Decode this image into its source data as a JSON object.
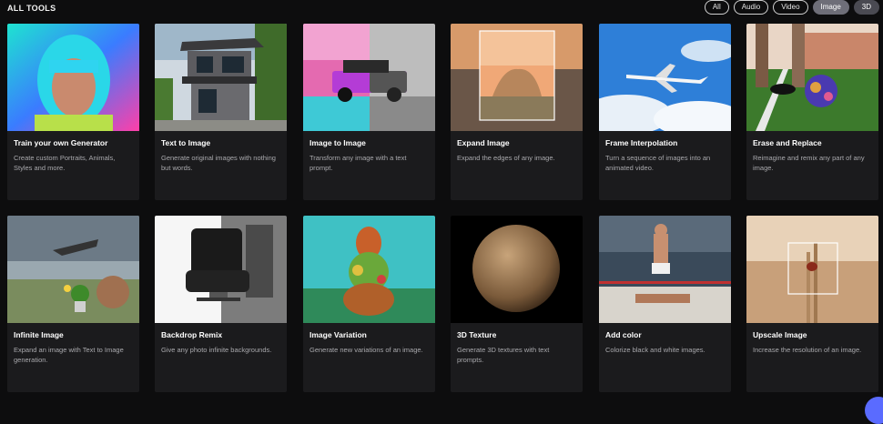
{
  "header": {
    "title": "ALL TOOLS"
  },
  "filters": [
    "All",
    "Audio",
    "Video",
    "Image",
    "3D"
  ],
  "cards": [
    {
      "title": "Train your own Generator",
      "desc": "Create custom Portraits, Animals, Styles and more."
    },
    {
      "title": "Text to Image",
      "desc": "Generate original images with nothing but words."
    },
    {
      "title": "Image to Image",
      "desc": "Transform any image with a text prompt."
    },
    {
      "title": "Expand Image",
      "desc": "Expand the edges of any image."
    },
    {
      "title": "Frame Interpolation",
      "desc": "Turn a sequence of images into an animated video."
    },
    {
      "title": "Erase and Replace",
      "desc": "Reimagine and remix any part of any image."
    },
    {
      "title": "Infinite Image",
      "desc": "Expand an image with Text to Image generation."
    },
    {
      "title": "Backdrop Remix",
      "desc": "Give any photo infinite backgrounds."
    },
    {
      "title": "Image Variation",
      "desc": "Generate new variations of an image."
    },
    {
      "title": "3D Texture",
      "desc": "Generate 3D textures with text prompts."
    },
    {
      "title": "Add color",
      "desc": "Colorize black and white images."
    },
    {
      "title": "Upscale Image",
      "desc": "Increase the resolution of an image."
    }
  ]
}
